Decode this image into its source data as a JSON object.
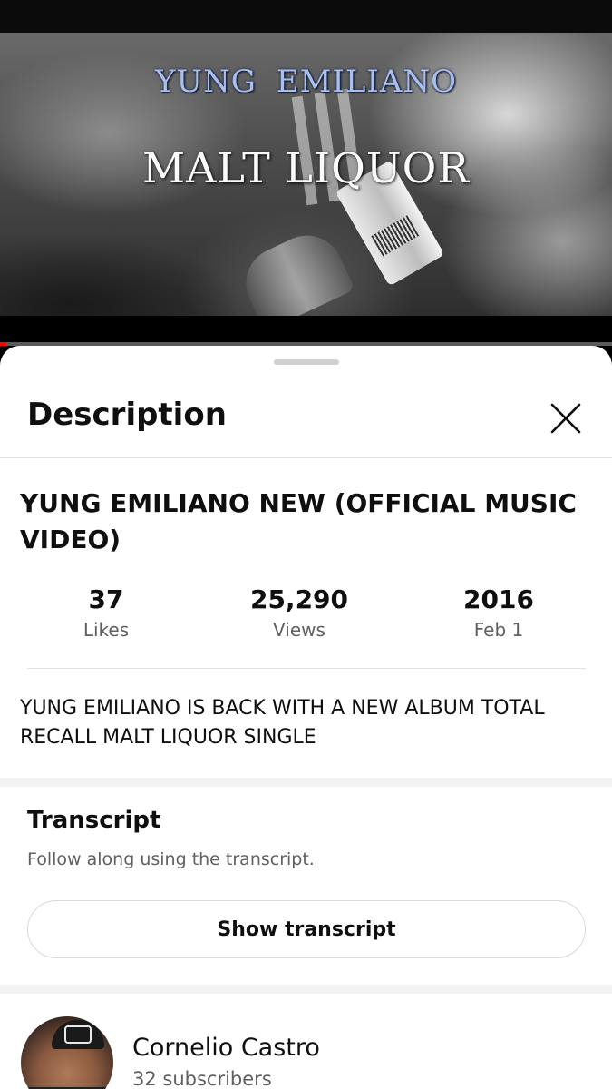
{
  "video": {
    "artist_overlay": "YUNG EMILIANO",
    "song_overlay": "MALT LIQUOR",
    "progress_percent": 1,
    "progress_color": "#ff0000"
  },
  "sheet": {
    "title": "Description",
    "close_icon": "close-icon"
  },
  "video_info": {
    "title": "YUNG EMILIANO NEW (OFFICIAL MUSIC VIDEO)",
    "stats": [
      {
        "value": "37",
        "label": "Likes"
      },
      {
        "value": "25,290",
        "label": "Views"
      },
      {
        "value": "2016",
        "label": "Feb 1"
      }
    ],
    "description": "YUNG EMILIANO IS BACK WITH A NEW ALBUM TOTAL RECALL MALT LIQUOR SINGLE"
  },
  "transcript": {
    "title": "Transcript",
    "subtitle": "Follow along using the transcript.",
    "button_label": "Show transcript"
  },
  "channel": {
    "name": "Cornelio Castro",
    "subscribers": "32 subscribers"
  }
}
